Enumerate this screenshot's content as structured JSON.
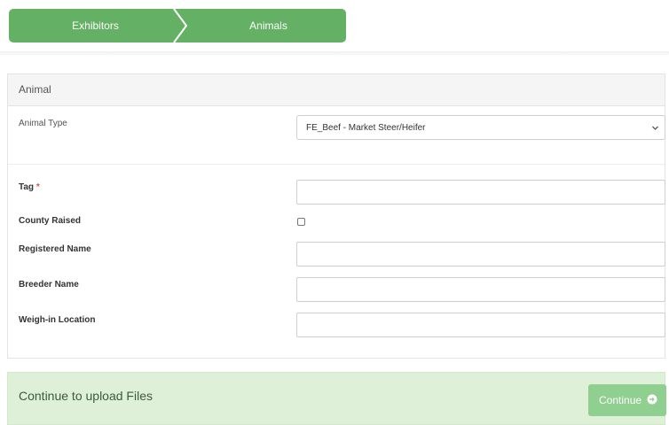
{
  "steps": [
    {
      "label": "Exhibitors"
    },
    {
      "label": "Animals"
    }
  ],
  "panel": {
    "title": "Animal",
    "animal_type": {
      "label": "Animal Type",
      "selected": "FE_Beef - Market Steer/Heifer"
    },
    "fields": {
      "tag": {
        "label": "Tag",
        "required_mark": "*",
        "value": ""
      },
      "county_raised": {
        "label": "County Raised",
        "checked": false
      },
      "registered_name": {
        "label": "Registered Name",
        "value": ""
      },
      "breeder_name": {
        "label": "Breeder Name",
        "value": ""
      },
      "weigh_in_location": {
        "label": "Weigh-in Location",
        "value": ""
      }
    }
  },
  "action_bar": {
    "text": "Continue to upload Files",
    "button_label": "Continue",
    "button_icon": "arrow-circle-right-icon"
  },
  "colors": {
    "step_green": "#64b064",
    "action_bg": "#dff0d8",
    "button_green": "#8fcf8f"
  }
}
